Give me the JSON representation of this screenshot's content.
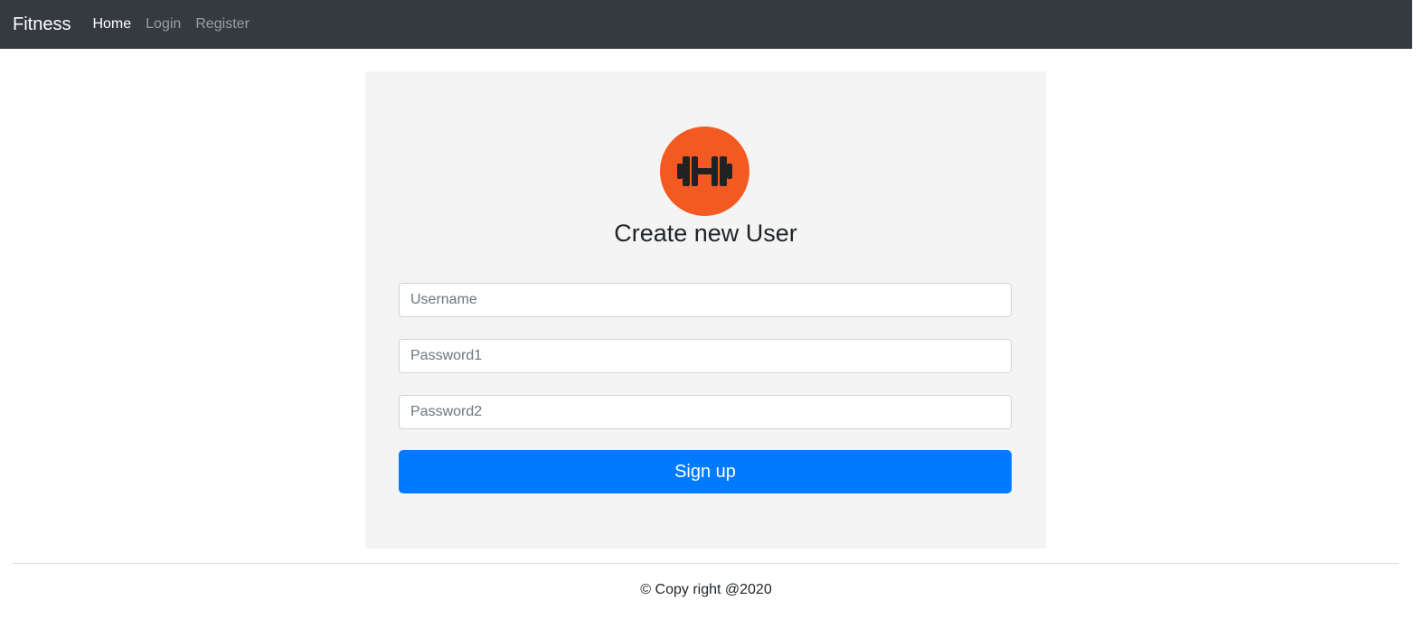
{
  "navbar": {
    "brand": "Fitness",
    "links": [
      {
        "label": "Home",
        "active": true
      },
      {
        "label": "Login",
        "active": false
      },
      {
        "label": "Register",
        "active": false
      }
    ]
  },
  "form": {
    "logo_icon": "dumbbell-icon",
    "heading": "Create new User",
    "username_placeholder": "Username",
    "password1_placeholder": "Password1",
    "password2_placeholder": "Password2",
    "submit_label": "Sign up"
  },
  "footer": {
    "text": "© Copy right @2020"
  },
  "colors": {
    "navbar_bg": "#343a40",
    "logo_bg": "#f35a22",
    "primary_button": "#007bff",
    "card_bg": "#f4f4f4"
  }
}
